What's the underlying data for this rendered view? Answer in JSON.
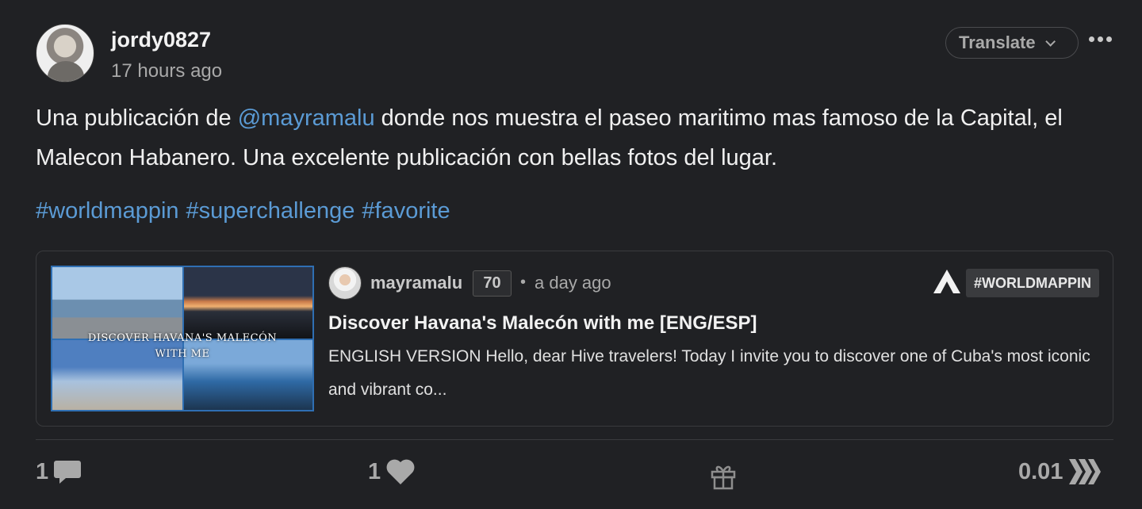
{
  "post": {
    "author": "jordy0827",
    "time_ago": "17 hours ago",
    "translate_label": "Translate",
    "body_before": "Una publicación de ",
    "mention": "@mayramalu",
    "body_after": " donde nos muestra el paseo maritimo mas famoso de la Capital, el Malecon Habanero. Una excelente publicación con bellas fotos del lugar.",
    "tags": [
      "#worldmappin",
      "#superchallenge",
      "#favorite"
    ]
  },
  "linked_post": {
    "thumbnail_text_line1": "DISCOVER HAVANA'S MALECÓN",
    "thumbnail_text_line2": "WITH ME",
    "author": "mayramalu",
    "reputation": "70",
    "separator": "•",
    "time_ago": "a day ago",
    "community": "#WORLDMAPPIN",
    "title": "Discover Havana's Malecón with me [ENG/ESP]",
    "summary": "ENGLISH VERSION Hello, dear Hive travelers! Today I invite you to discover one of Cuba's most iconic and vibrant co..."
  },
  "actions": {
    "comments_count": "1",
    "likes_count": "1",
    "payout": "0.01"
  },
  "colors": {
    "background": "#202124",
    "link": "#5b9bd5",
    "muted": "#a9a9a9",
    "border": "#3a3b3e"
  },
  "icons": [
    "more-icon",
    "chevron-down-icon",
    "comment-icon",
    "heart-icon",
    "gift-icon",
    "hive-icon",
    "community-icon"
  ]
}
